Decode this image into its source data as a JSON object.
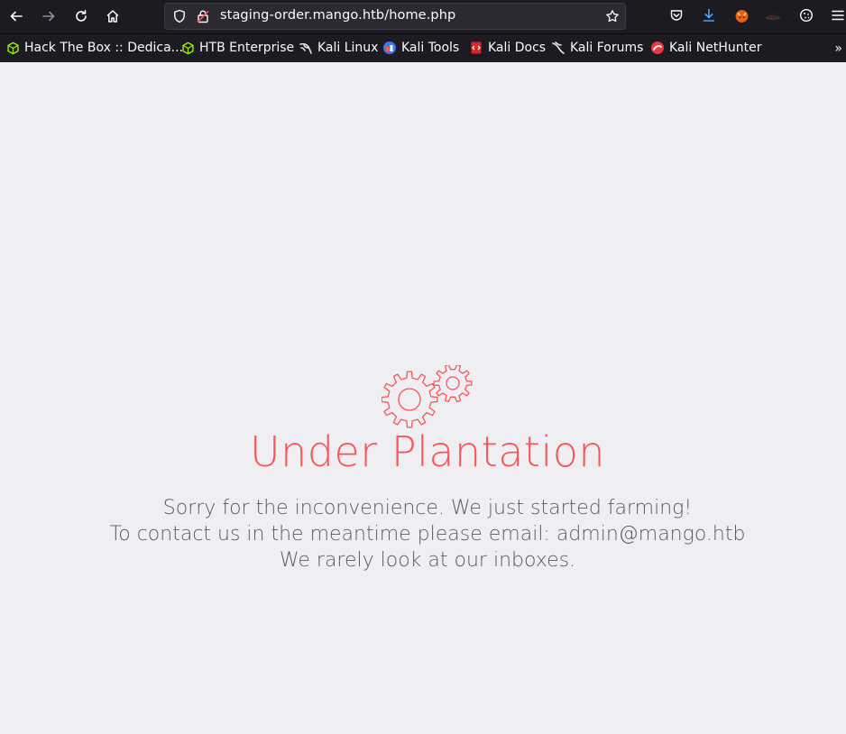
{
  "browser": {
    "url": "staging-order.mango.htb/home.php",
    "bookmarks": [
      {
        "label": "Hack The Box :: Dedica...",
        "icon": "htb-cube-icon"
      },
      {
        "label": "HTB Enterprise",
        "icon": "htb-cube-icon"
      },
      {
        "label": "Kali Linux",
        "icon": "kali-dragon-icon"
      },
      {
        "label": "Kali Tools",
        "icon": "kali-tools-icon"
      },
      {
        "label": "Kali Docs",
        "icon": "kali-docs-icon"
      },
      {
        "label": "Kali Forums",
        "icon": "kali-dragon-icon"
      },
      {
        "label": "Kali NetHunter",
        "icon": "nethunter-icon"
      }
    ],
    "overflow_label": "»"
  },
  "page": {
    "heading": "Under Plantation",
    "lines": [
      "Sorry for the inconvenience. We just started farming!",
      "To contact us in the meantime please email: admin@mango.htb",
      "We rarely look at our inboxes."
    ]
  },
  "colors": {
    "accent": "#f4565a",
    "background": "#efeff3",
    "chrome": "#1c1b22"
  }
}
